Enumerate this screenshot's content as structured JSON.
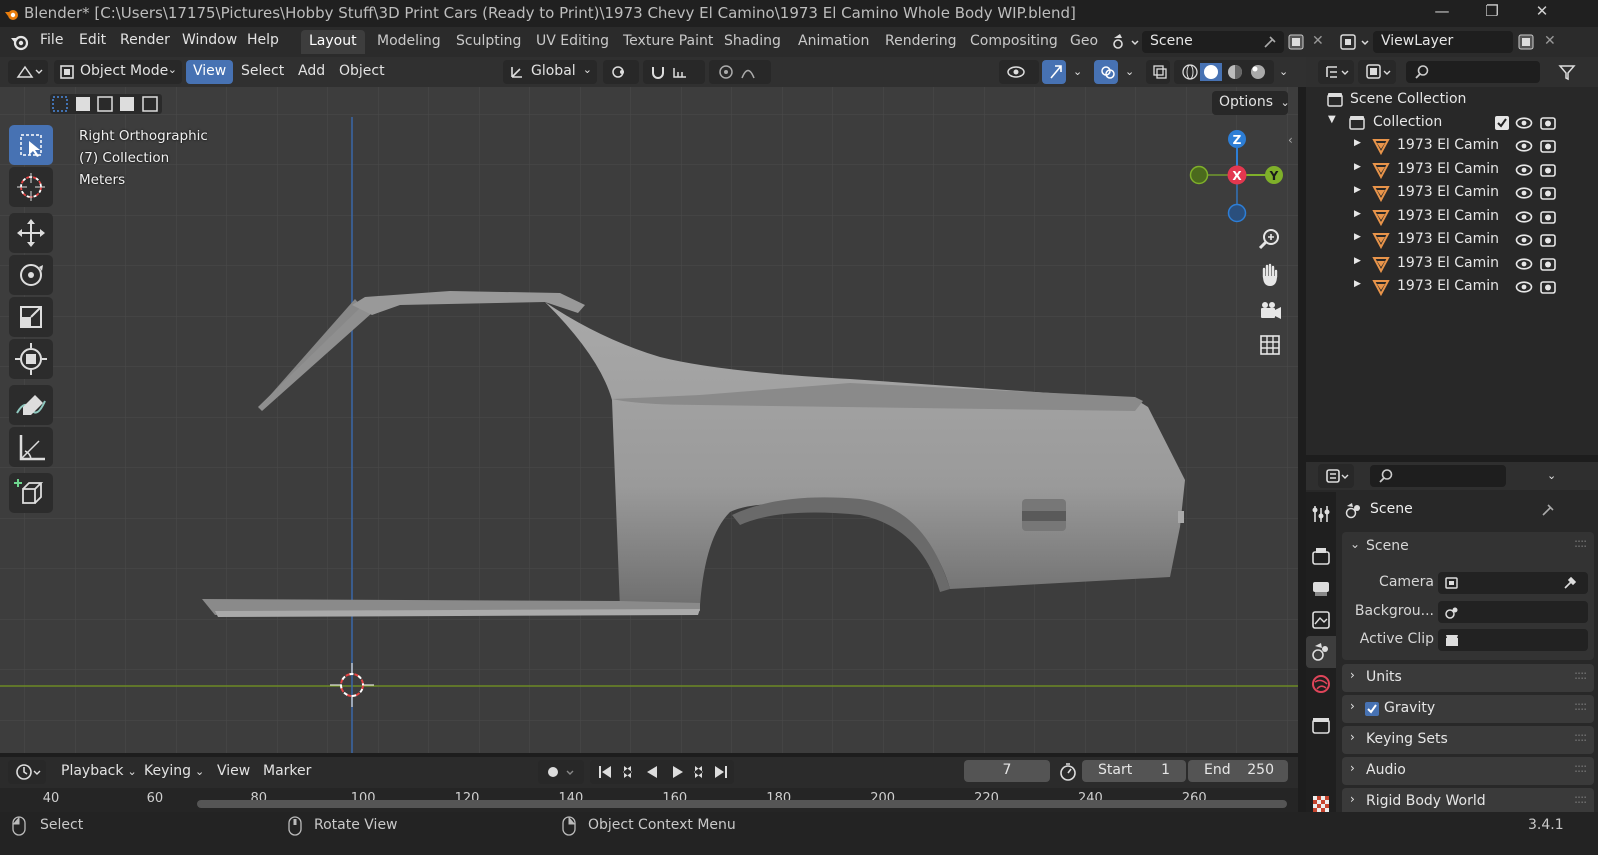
{
  "titlebar": {
    "title": "Blender* [C:\\Users\\17175\\Pictures\\Hobby Stuff\\3D Print Cars (Ready to Print)\\1973 Chevy El Camino\\1973 El Camino Whole Body WIP.blend]",
    "minimize": "—",
    "maximize": "❐",
    "close": "✕"
  },
  "menus": [
    "File",
    "Edit",
    "Render",
    "Window",
    "Help"
  ],
  "workspaces": [
    "Layout",
    "Modeling",
    "Sculpting",
    "UV Editing",
    "Texture Paint",
    "Shading",
    "Animation",
    "Rendering",
    "Compositing",
    "Geo"
  ],
  "scene_field": "Scene",
  "viewlayer_field": "ViewLayer",
  "viewport_header": {
    "mode": "Object Mode",
    "menus": [
      "View",
      "Select",
      "Add",
      "Object"
    ],
    "orientation": "Global",
    "options": "Options"
  },
  "viewport_overlay": {
    "view_name": "Right Orthographic",
    "collection": "(7) Collection",
    "units": "Meters"
  },
  "gizmo": {
    "z": "Z",
    "x": "X",
    "y": "Y"
  },
  "outliner": {
    "root": "Scene Collection",
    "collection": "Collection",
    "objects": [
      "1973 El Camin",
      "1973 El Camin",
      "1973 El Camin",
      "1973 El Camin",
      "1973 El Camin",
      "1973 El Camin",
      "1973 El Camin"
    ]
  },
  "properties": {
    "context": "Scene",
    "panel_scene": "Scene",
    "camera_label": "Camera",
    "background_label": "Backgrou...",
    "active_clip_label": "Active Clip",
    "panels": [
      "Units",
      "Gravity",
      "Keying Sets",
      "Audio",
      "Rigid Body World"
    ]
  },
  "timeline": {
    "menus": [
      "Playback",
      "Keying",
      "View",
      "Marker"
    ],
    "current_frame": "7",
    "start_label": "Start",
    "start_value": "1",
    "end_label": "End",
    "end_value": "250",
    "ruler": [
      "40",
      "60",
      "80",
      "100",
      "120",
      "140",
      "160",
      "180",
      "200",
      "220",
      "240",
      "260"
    ]
  },
  "statusbar": {
    "select": "Select",
    "rotate": "Rotate View",
    "context_menu": "Object Context Menu",
    "version": "3.4.1"
  },
  "colors": {
    "accent": "#4772b3",
    "axis_x": "#e3374f",
    "axis_y": "#7fb02a",
    "axis_z": "#2d7ed6",
    "object_icon": "#e8944a"
  }
}
